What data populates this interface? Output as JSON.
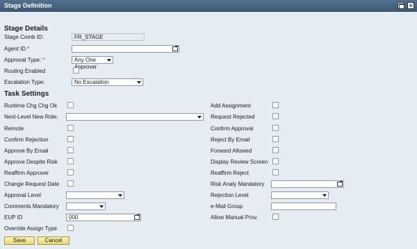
{
  "window": {
    "title": "Stage Definition"
  },
  "sections": {
    "stage_details": "Stage Details",
    "task_settings": "Task Settings"
  },
  "stage_details": {
    "stage_comb_id": {
      "label": "Stage Comb ID:",
      "value": "FR_STAGE"
    },
    "agent_id": {
      "label": "Agent ID",
      "required_mark": "*",
      "value": ""
    },
    "approval_type": {
      "label": "Approval Type:",
      "required_mark": "*",
      "value": "Any One Approver"
    },
    "routing_enabled": {
      "label": "Routing Enabled",
      "checked": false
    },
    "escalation_type": {
      "label": "Escalation Type:",
      "value": "No Escalation"
    }
  },
  "task_settings": {
    "left": [
      {
        "name": "runtime-chg",
        "label": "Runtime Chg Chg Ok",
        "kind": "checkbox",
        "checked": false
      },
      {
        "name": "next-level-new-role",
        "label": "Next-Level New Role:",
        "kind": "select",
        "value": ""
      },
      {
        "name": "remote",
        "label": "Remote",
        "kind": "checkbox",
        "checked": false
      },
      {
        "name": "confirm-rejection",
        "label": "Confirm Rejection",
        "kind": "checkbox",
        "checked": false
      },
      {
        "name": "approve-by-email",
        "label": "Approve By Email",
        "kind": "checkbox",
        "checked": false
      },
      {
        "name": "approve-despite-risk",
        "label": "Approve Despite Risk",
        "kind": "checkbox",
        "checked": false
      },
      {
        "name": "reaffirm-approver",
        "label": "Reaffirm Approver",
        "kind": "checkbox",
        "checked": false
      },
      {
        "name": "change-request-date",
        "label": "Change Request Date",
        "kind": "checkbox",
        "checked": false
      },
      {
        "name": "approval-level",
        "label": "Approval Level",
        "kind": "select",
        "value": ""
      },
      {
        "name": "comments-mandatory",
        "label": "Comments Mandatory",
        "kind": "select",
        "value": ""
      },
      {
        "name": "eup-id",
        "label": "EUP ID",
        "kind": "f4",
        "value": "000"
      },
      {
        "name": "override-assign-type",
        "label": "Override Assign Type",
        "kind": "checkbox",
        "checked": false
      }
    ],
    "right": [
      {
        "name": "add-assignment",
        "label": "Add Assignment",
        "kind": "checkbox",
        "checked": false
      },
      {
        "name": "request-rejected",
        "label": "Request Rejected",
        "kind": "checkbox",
        "checked": false
      },
      {
        "name": "confirm-approval",
        "label": "Confirm Approval",
        "kind": "checkbox",
        "checked": false
      },
      {
        "name": "reject-by-email",
        "label": "Reject By Email",
        "kind": "checkbox",
        "checked": false
      },
      {
        "name": "forward-allowed",
        "label": "Forward Allowed",
        "kind": "checkbox",
        "checked": false
      },
      {
        "name": "display-review-screen",
        "label": "Display Review Screen",
        "kind": "checkbox",
        "checked": false
      },
      {
        "name": "reaffirm-reject",
        "label": "Reaffirm Reject",
        "kind": "checkbox",
        "checked": false
      },
      {
        "name": "risk-analy-mandatory",
        "label": "Risk Analy Mandatory",
        "kind": "f4",
        "value": ""
      },
      {
        "name": "rejection-level",
        "label": "Rejection Level",
        "kind": "select",
        "value": ""
      },
      {
        "name": "email-group",
        "label": "e-Mail Group",
        "kind": "text",
        "value": ""
      },
      {
        "name": "allow-manual-prov",
        "label": "Allow Manual Prov.",
        "kind": "checkbox",
        "checked": false
      }
    ]
  },
  "buttons": {
    "save": "Save",
    "cancel": "Cancel"
  }
}
